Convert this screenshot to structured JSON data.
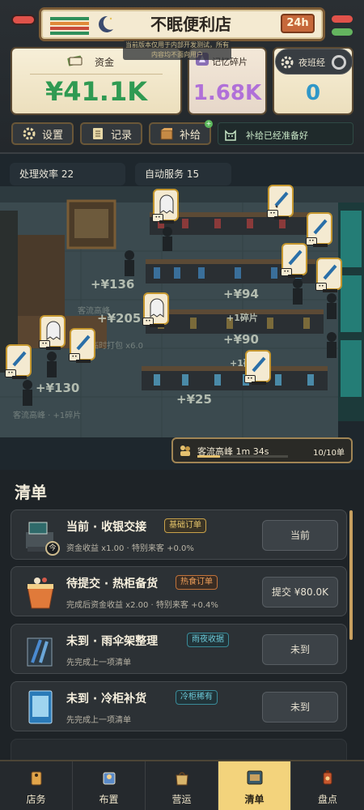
{
  "header": {
    "store_name": "不眠便利店",
    "hours_badge": "24h",
    "notice": "当前版本仅用于内部开发测试，所有内容均不面向用户",
    "money_label": "资金",
    "money_value": "¥41.1K",
    "shard_label": "记忆碎片",
    "shard_value": "1.68K",
    "night_label": "夜班经",
    "night_value": "0",
    "buttons": {
      "settings": "设置",
      "records": "记录",
      "supply": "补给"
    },
    "restock_status": "补给已经准备好",
    "colors": {
      "money": "#2f9a52",
      "shard": "#b070d8",
      "night": "#2f97c8",
      "sign_bg": "#f4ead1"
    }
  },
  "scene": {
    "efficiency": "处理效率 22",
    "auto_service": "自动服务 15",
    "floats": [
      "+¥136",
      "+¥205",
      "+¥94",
      "+1碎片",
      "+¥90",
      "+1碎片",
      "+¥130",
      "+¥25"
    ],
    "ghost_texts": [
      "客流高峰",
      "临时打包 x6.0",
      "客流高峰 · +1碎片"
    ],
    "rush": {
      "label": "客流高峰 1m 34s",
      "count": "10/10单",
      "progress": 0.25
    }
  },
  "list": {
    "title": "清单",
    "cards": [
      {
        "name": "当前 · 收银交接",
        "badge": "基础订单",
        "desc": "资金收益 x1.00 · 特别来客 +0.0%",
        "action": "当前",
        "icon": "cash-register-icon"
      },
      {
        "name": "待提交 · 热柜备货",
        "badge": "热食订单",
        "desc": "完成后资金收益 x2.00 · 特别来客 +0.4%",
        "action": "提交 ¥80.0K",
        "icon": "noodle-cup-icon"
      },
      {
        "name": "未到 · 雨伞架整理",
        "badge": "雨夜收据",
        "desc": "先完成上一项清单",
        "action": "未到",
        "icon": "umbrella-rack-icon"
      },
      {
        "name": "未到 · 冷柜补货",
        "badge": "冷柜稀有",
        "desc": "先完成上一项清单",
        "action": "未到",
        "icon": "fridge-icon"
      }
    ],
    "lock_glyph": "今"
  },
  "nav": {
    "items": [
      {
        "label": "店务",
        "icon": "store-tag-icon"
      },
      {
        "label": "布置",
        "icon": "badge-icon"
      },
      {
        "label": "营运",
        "icon": "bag-icon"
      },
      {
        "label": "清单",
        "icon": "checklist-icon"
      },
      {
        "label": "盘点",
        "icon": "lantern-icon"
      }
    ],
    "active": "清单"
  }
}
